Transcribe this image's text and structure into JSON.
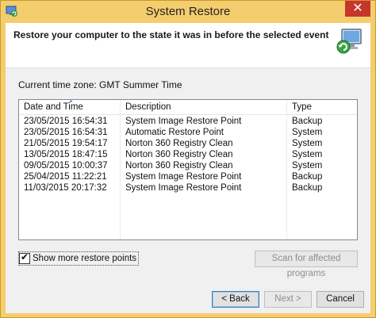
{
  "window": {
    "title": "System Restore",
    "close_glyph": "✕",
    "app_icon": "system-restore-icon"
  },
  "header": {
    "instruction": "Restore your computer to the state it was in before the selected event",
    "icon": "system-restore-computer-icon"
  },
  "timezone": "Current time zone: GMT Summer Time",
  "list": {
    "columns": [
      "Date and Time",
      "Description",
      "Type"
    ],
    "rows": [
      {
        "date": "23/05/2015 16:54:31",
        "description": "System Image Restore Point",
        "type": "Backup"
      },
      {
        "date": "23/05/2015 16:54:31",
        "description": "Automatic Restore Point",
        "type": "System"
      },
      {
        "date": "21/05/2015 19:54:17",
        "description": "Norton 360 Registry Clean",
        "type": "System"
      },
      {
        "date": "13/05/2015 18:47:15",
        "description": "Norton 360 Registry Clean",
        "type": "System"
      },
      {
        "date": "09/05/2015 10:00:37",
        "description": "Norton 360 Registry Clean",
        "type": "System"
      },
      {
        "date": "25/04/2015 11:22:21",
        "description": "System Image Restore Point",
        "type": "Backup"
      },
      {
        "date": "11/03/2015 20:17:32",
        "description": "System Image Restore Point",
        "type": "Backup"
      }
    ]
  },
  "show_more": {
    "label": "Show more restore points",
    "checked": true
  },
  "buttons": {
    "scan": "Scan for affected programs",
    "back": "< Back",
    "next": "Next >",
    "cancel": "Cancel"
  }
}
